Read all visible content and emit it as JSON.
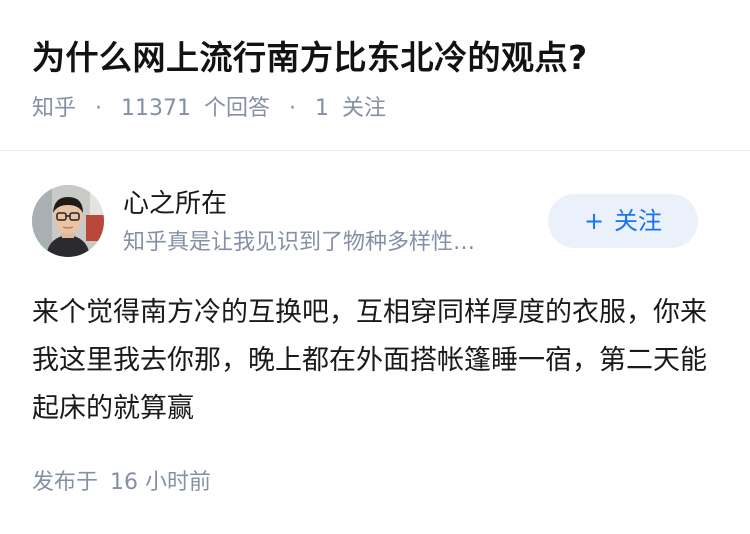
{
  "question": {
    "title": "为什么网上流行南方比东北冷的观点?",
    "source": "知乎",
    "separator": "·",
    "answer_count": "11371",
    "answer_unit": "个回答",
    "follow_count": "1",
    "follow_unit": "关注"
  },
  "answer": {
    "author": {
      "name": "心之所在",
      "bio": "知乎真是让我见识到了物种多样性…",
      "avatar_icon": "user-avatar-photo"
    },
    "follow_button": {
      "icon": "plus-icon",
      "icon_glyph": "+",
      "label": "关注"
    },
    "content": "来个觉得南方冷的互换吧，互相穿同样厚度的衣服，你来我这里我去你那，晚上都在外面搭帐篷睡一宿，第二天能起床的就算赢",
    "published_verb": "发布于",
    "published_time": "16 小时前"
  },
  "colors": {
    "accent": "#1772f6",
    "button_bg": "#eaf1fb",
    "meta_text": "#8590a6",
    "title_text": "#121212"
  }
}
